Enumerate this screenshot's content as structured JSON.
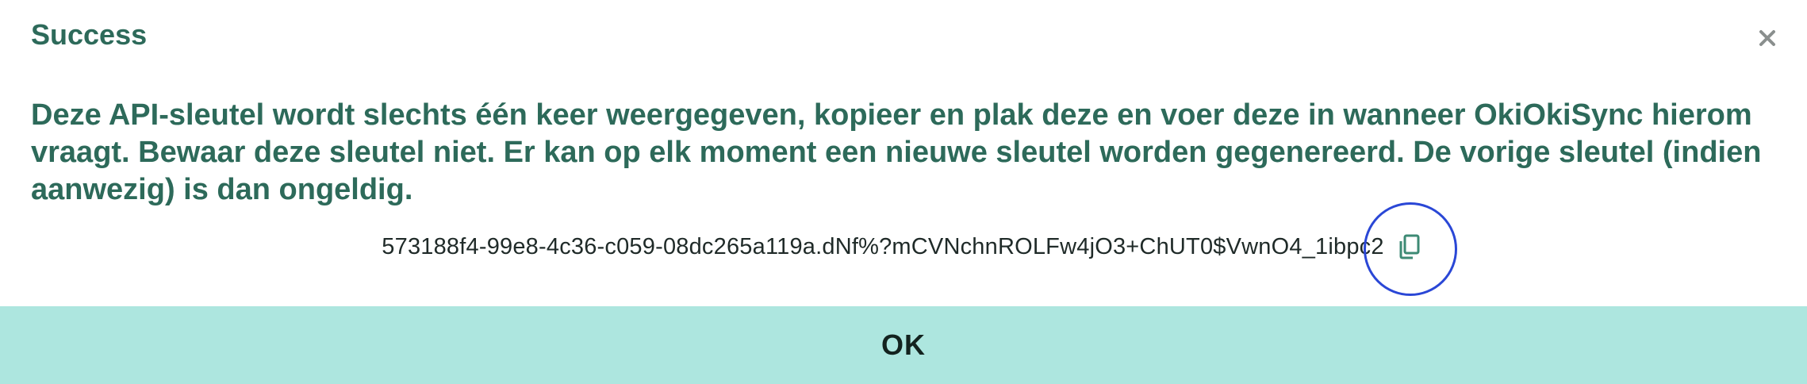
{
  "dialog": {
    "title": "Success",
    "message": "Deze API-sleutel wordt slechts één keer weergegeven, kopieer en plak deze en voer deze in wanneer OkiOkiSync hierom vraagt. Bewaar deze sleutel niet. Er kan op elk moment een nieuwe sleutel worden gegenereerd. De vorige sleutel (indien aanwezig) is dan ongeldig.",
    "api_key": "573188f4-99e8-4c36-c059-08dc265a119a.dNf%?mCVNchnROLFw4jO3+ChUT0$VwnO4_1ibpc2",
    "ok_label": "OK",
    "icons": {
      "close": "close-icon",
      "copy": "copy-icon"
    }
  },
  "colors": {
    "heading": "#2d6a5a",
    "ok_bar": "#ade6df",
    "highlight_ring": "#2a47d6",
    "copy_icon": "#3d8a74"
  }
}
